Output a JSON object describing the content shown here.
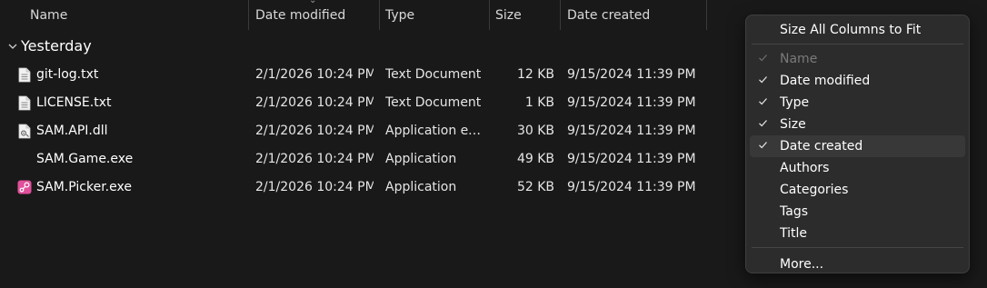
{
  "columns": {
    "name": "Name",
    "date_modified": "Date modified",
    "type": "Type",
    "size": "Size",
    "date_created": "Date created"
  },
  "group": {
    "label": "Yesterday"
  },
  "files": [
    {
      "name": "git-log.txt",
      "date_modified": "2/1/2026 10:24 PM",
      "type": "Text Document",
      "size": "12 KB",
      "date_created": "9/15/2024 11:39 PM",
      "icon": "text-file-icon"
    },
    {
      "name": "LICENSE.txt",
      "date_modified": "2/1/2026 10:24 PM",
      "type": "Text Document",
      "size": "1 KB",
      "date_created": "9/15/2024 11:39 PM",
      "icon": "text-file-icon"
    },
    {
      "name": "SAM.API.dll",
      "date_modified": "2/1/2026 10:24 PM",
      "type": "Application ex...",
      "size": "30 KB",
      "date_created": "9/15/2024 11:39 PM",
      "icon": "dll-file-icon"
    },
    {
      "name": "SAM.Game.exe",
      "date_modified": "2/1/2026 10:24 PM",
      "type": "Application",
      "size": "49 KB",
      "date_created": "9/15/2024 11:39 PM",
      "icon": ""
    },
    {
      "name": "SAM.Picker.exe",
      "date_modified": "2/1/2026 10:24 PM",
      "type": "Application",
      "size": "52 KB",
      "date_created": "9/15/2024 11:39 PM",
      "icon": "sam-picker-app-icon"
    }
  ],
  "context_menu": {
    "size_all": "Size All Columns to Fit",
    "items": [
      {
        "label": "Name",
        "checked": true,
        "disabled": true
      },
      {
        "label": "Date modified",
        "checked": true,
        "disabled": false
      },
      {
        "label": "Type",
        "checked": true,
        "disabled": false
      },
      {
        "label": "Size",
        "checked": true,
        "disabled": false
      },
      {
        "label": "Date created",
        "checked": true,
        "disabled": false,
        "hovered": true
      },
      {
        "label": "Authors",
        "checked": false,
        "disabled": false
      },
      {
        "label": "Categories",
        "checked": false,
        "disabled": false
      },
      {
        "label": "Tags",
        "checked": false,
        "disabled": false
      },
      {
        "label": "Title",
        "checked": false,
        "disabled": false
      }
    ],
    "more": "More..."
  },
  "colors": {
    "background": "#191919",
    "menu_background": "#2c2c2c",
    "hover": "#383838",
    "disabled_text": "#7a7a7a",
    "picker_icon_pink": "#e0509b"
  }
}
